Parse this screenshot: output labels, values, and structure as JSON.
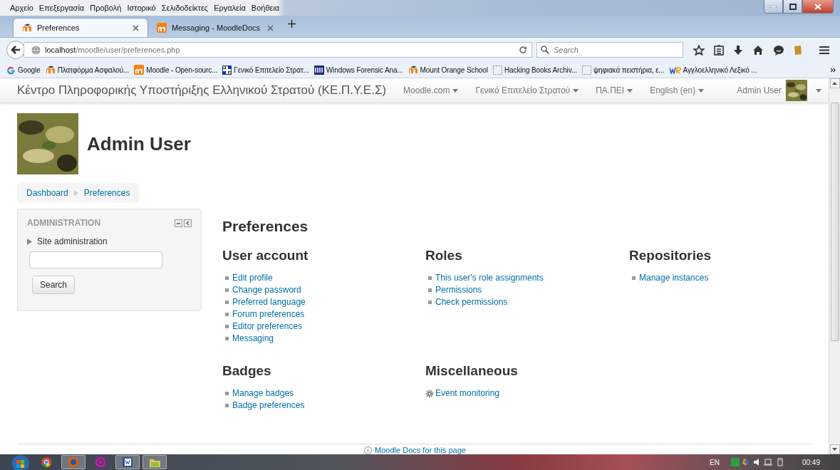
{
  "menu_bar": [
    "Αρχείο",
    "Επεξεργασία",
    "Προβολή",
    "Ιστορικό",
    "Σελιδοδείκτες",
    "Εργαλεία",
    "Βοήθεια"
  ],
  "tabs": [
    {
      "label": "Preferences",
      "selected": true,
      "kind": "moodle"
    },
    {
      "label": "Messaging - MoodleDocs",
      "selected": false,
      "kind": "moodle-box"
    }
  ],
  "address": {
    "host": "localhost",
    "path": "/moodle/user/preferences.php"
  },
  "search": {
    "placeholder": "Search"
  },
  "bookmarks": [
    {
      "label": "Google",
      "kind": "google"
    },
    {
      "label": "Πλατφόρμα Ασφαλού...",
      "kind": "moodle"
    },
    {
      "label": "Moodle - Open-sourc...",
      "kind": "moodle-box"
    },
    {
      "label": "Γενικό Επιτελείο Στρατ...",
      "kind": "flag"
    },
    {
      "label": "Windows Forensic Ana...",
      "kind": "logo"
    },
    {
      "label": "Mount Orange School",
      "kind": "moodle"
    },
    {
      "label": "Hacking Books Archiv...",
      "kind": "blank"
    },
    {
      "label": "ψηφιακά πειστήρια, ε...",
      "kind": "blank"
    },
    {
      "label": "Αγγλοελληνικό Λεξικό ...",
      "kind": "wr"
    }
  ],
  "site": {
    "title": "Κέντρο Πληροφορικής Υποστήριξης Ελληνικού Στρατού (ΚΕ.Π.Υ.Ε.Σ)",
    "menus": [
      "Moodle.com",
      "Γενικό Επιτελείο Στρατού",
      "ΠΑ.ΠΕΙ",
      "English (en)"
    ],
    "user": "Admin User"
  },
  "profile": {
    "name": "Admin User"
  },
  "breadcrumb": [
    "Dashboard",
    "Preferences"
  ],
  "admin_block": {
    "title": "ADMINISTRATION",
    "items": [
      {
        "label": "Site administration",
        "expanded": false
      }
    ],
    "search_button": "Search"
  },
  "page_title": "Preferences",
  "sections": [
    {
      "heading": "User account",
      "links": [
        {
          "label": "Edit profile",
          "kind": "bullet"
        },
        {
          "label": "Change password",
          "kind": "bullet"
        },
        {
          "label": "Preferred language",
          "kind": "bullet"
        },
        {
          "label": "Forum preferences",
          "kind": "bullet"
        },
        {
          "label": "Editor preferences",
          "kind": "bullet"
        },
        {
          "label": "Messaging",
          "kind": "bullet"
        }
      ]
    },
    {
      "heading": "Roles",
      "links": [
        {
          "label": "This user's role assignments",
          "kind": "bullet"
        },
        {
          "label": "Permissions",
          "kind": "bullet"
        },
        {
          "label": "Check permissions",
          "kind": "bullet"
        }
      ]
    },
    {
      "heading": "Repositories",
      "links": [
        {
          "label": "Manage instances",
          "kind": "bullet"
        }
      ]
    },
    {
      "heading": "Badges",
      "links": [
        {
          "label": "Manage badges",
          "kind": "bullet"
        },
        {
          "label": "Badge preferences",
          "kind": "bullet"
        }
      ]
    },
    {
      "heading": "Miscellaneous",
      "links": [
        {
          "label": "Event monitoring",
          "kind": "gear"
        }
      ]
    }
  ],
  "footer": {
    "docs_link": "Moodle Docs for this page"
  },
  "taskbar": {
    "language": "EN",
    "clock": "00:49"
  }
}
